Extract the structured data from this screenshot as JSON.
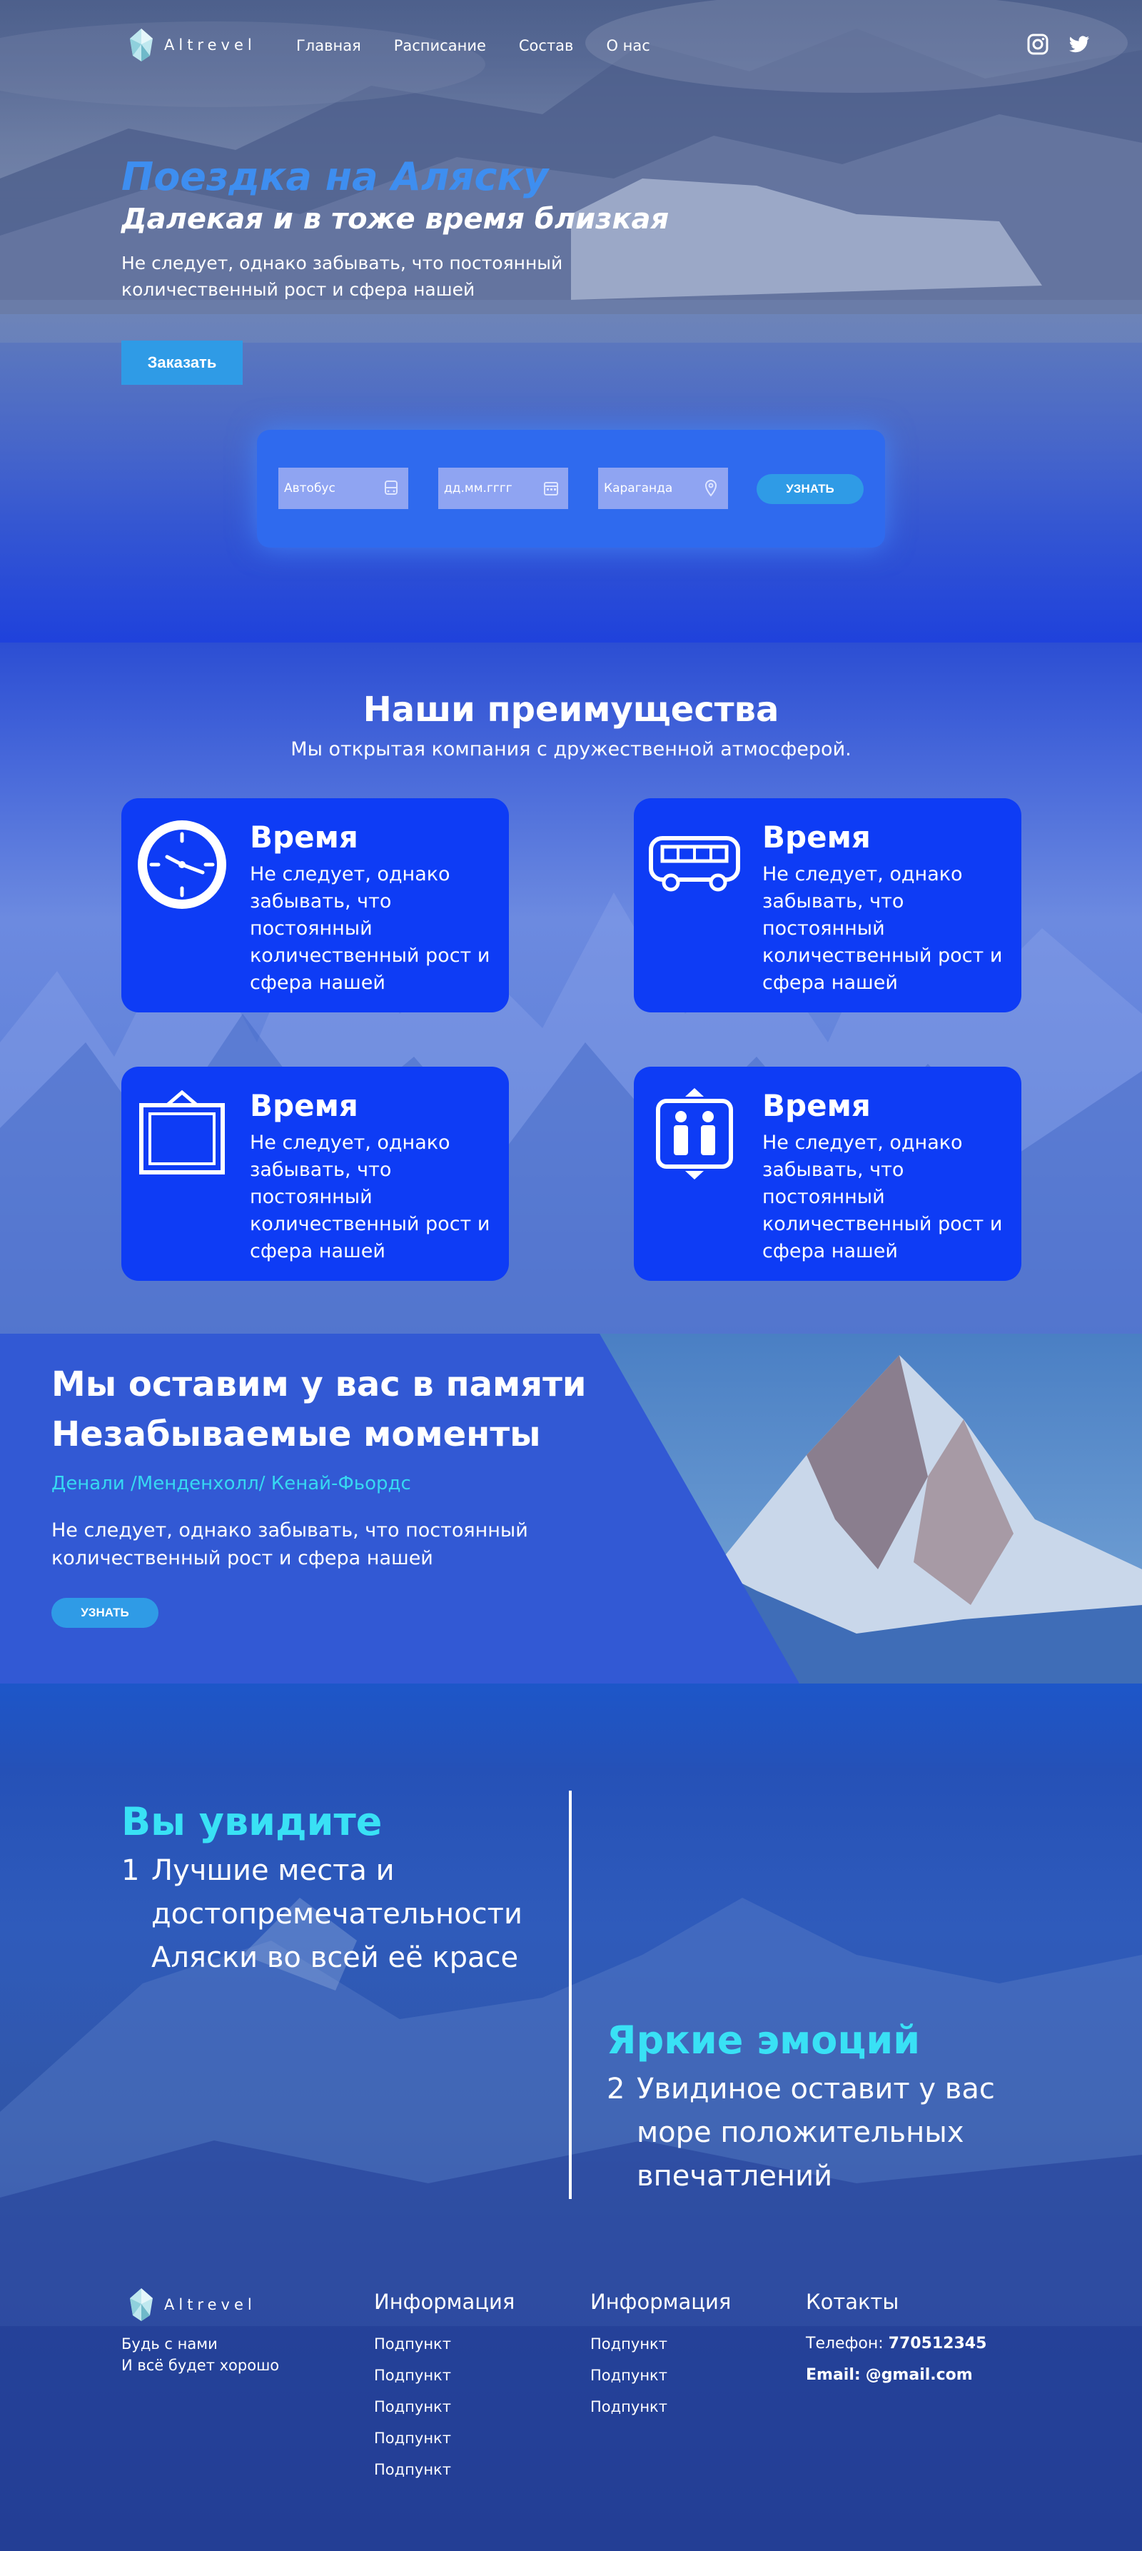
{
  "brand": {
    "name": "Altrevel"
  },
  "nav": {
    "items": [
      "Главная",
      "Расписание",
      "Состав",
      "О нас"
    ]
  },
  "social": {
    "icons": [
      "instagram-icon",
      "twitter-icon"
    ]
  },
  "hero": {
    "title": "Поездка на Аляску",
    "subtitle": "Далекая и в тоже время близкая",
    "description": "Не следует, однако забывать, что постоянный количественный рост и сфера нашей",
    "order_button": "Заказать"
  },
  "search": {
    "transport_placeholder": "Автобус",
    "date_placeholder": "дд.мм.гггг",
    "city_placeholder": "Караганда",
    "button": "УЗНАТЬ"
  },
  "advantages": {
    "title": "Наши преимущества",
    "subtitle": "Мы открытая компания с дружественной атмосферой.",
    "cards": [
      {
        "icon": "clock-icon",
        "title": "Время",
        "text": "Не следует, однако забывать, что постоянный количественный рост и сфера нашей"
      },
      {
        "icon": "bus-icon",
        "title": "Время",
        "text": "Не следует, однако забывать, что постоянный количественный рост и сфера нашей"
      },
      {
        "icon": "picture-frame-icon",
        "title": "Время",
        "text": "Не следует, однако забывать, что постоянный количественный рост и сфера нашей"
      },
      {
        "icon": "elevator-icon",
        "title": "Время",
        "text": "Не следует, однако забывать, что постоянный количественный рост и сфера нашей"
      }
    ]
  },
  "memories": {
    "title_line1": "Мы оставим у вас в памяти",
    "title_line2": "Незабываемые моменты",
    "links": "Денали /Менденхолл/ Кенай-Фьордс",
    "description": "Не следует, однако забывать, что постоянный количественный рост и сфера нашей",
    "button": "УЗНАТЬ"
  },
  "see": {
    "left": {
      "heading": "Вы увидите",
      "number": "1",
      "text": "Лучшие места и достопремечательности Аляски во всей её красе"
    },
    "right": {
      "heading": "Яркие эмоций",
      "number": "2",
      "text": "Увидиное оставит у вас море положительных впечатлений"
    }
  },
  "footer": {
    "tagline_1": "Будь с нами",
    "tagline_2": "И всё будет хорошо",
    "col1": {
      "heading": "Информация",
      "items": [
        "Подпункт",
        "Подпункт",
        "Подпункт",
        "Подпункт",
        "Подпункт"
      ]
    },
    "col2": {
      "heading": "Информация",
      "items": [
        "Подпункт",
        "Подпункт",
        "Подпункт"
      ]
    },
    "contacts": {
      "heading": "Котакты",
      "phone_label": "Телефон:",
      "phone": "770512345",
      "email_label": "Email:",
      "email": "@gmail.com"
    }
  },
  "colors": {
    "accent": "#2f9be6",
    "card": "#0e3cf5",
    "highlight": "#39e1f5",
    "title_blue": "#3e8ef0"
  }
}
